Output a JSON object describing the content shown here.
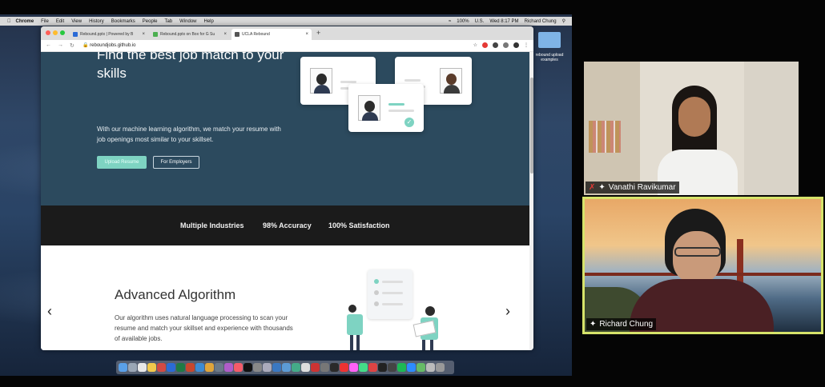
{
  "mac_menubar": {
    "apple_icon": "apple-icon",
    "app": "Chrome",
    "menus": [
      "File",
      "Edit",
      "View",
      "History",
      "Bookmarks",
      "People",
      "Tab",
      "Window",
      "Help"
    ],
    "battery": "100%",
    "input_lang": "U.S.",
    "datetime": "Wed 8:17 PM",
    "user": "Richard Chung"
  },
  "desktop": {
    "folder_label": "rebound upload examples"
  },
  "browser": {
    "tabs": [
      {
        "title": "Rebound.pptx | Powered by B",
        "color": "#2b6bd6"
      },
      {
        "title": "Rebound.pptx on Box for G Su",
        "color": "#4caf50"
      },
      {
        "title": "UCLA Rebound",
        "color": "#555555"
      }
    ],
    "new_tab": "+",
    "url": "reboundjobs.github.io"
  },
  "hero": {
    "title": "Find the best job match to your skills",
    "description": "With our machine learning algorithm, we match your resume with job openings most similar to your skillset.",
    "upload_button": "Upload Resume",
    "employers_button": "For Employers"
  },
  "stats": [
    "Multiple Industries",
    "98% Accuracy",
    "100% Satisfaction"
  ],
  "feature": {
    "title": "Advanced Algorithm",
    "description": "Our algorithm uses natural language processing to scan your resume and match your skillset and experience with thousands of available jobs.",
    "prev_arrow": "‹",
    "next_arrow": "›",
    "carousel_active": 1,
    "carousel_count": 4
  },
  "participants": [
    {
      "name": "Vanathi Ravikumar",
      "muted": true
    },
    {
      "name": "Richard Chung",
      "muted": false,
      "active_speaker": true
    }
  ],
  "colors": {
    "hero_bg": "#2c4a5e",
    "accent": "#7ed3c2",
    "stats_bg": "#1b1b1b",
    "speaker_border": "#d6e36a"
  }
}
